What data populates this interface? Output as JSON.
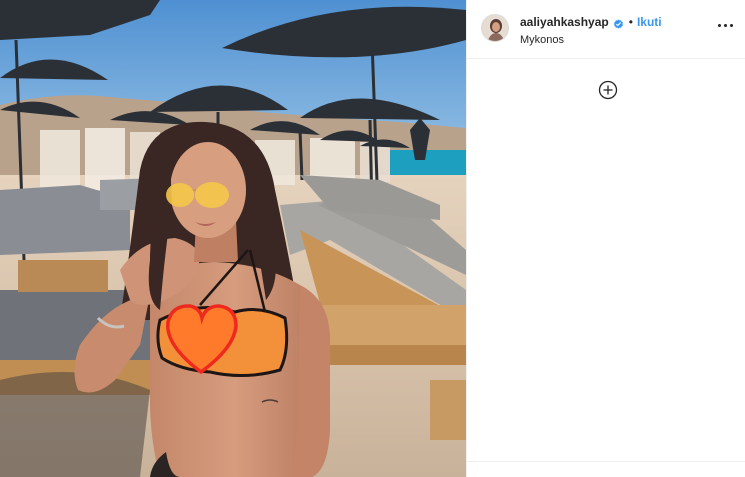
{
  "post": {
    "username": "aaliyahkashyap",
    "follow_label": "Ikuti",
    "separator": "•",
    "location": "Mykonos",
    "verified": true
  },
  "icons": {
    "verified": "verified-badge-icon",
    "more": "more-options-icon",
    "add": "add-circle-icon",
    "heart_sticker": "heart-icon"
  },
  "colors": {
    "link_blue": "#3897f0",
    "verified_blue": "#3897f0",
    "heart_red": "#ee2a1e",
    "sky": "#6aa6d6"
  }
}
